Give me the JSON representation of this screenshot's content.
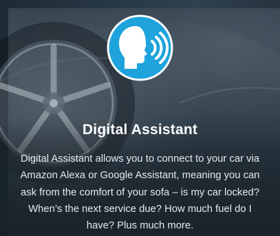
{
  "feature": {
    "title": "Digital Assistant",
    "description": "Digital Assistant allows you to connect to your car via Amazon Alexa or Google Assistant, meaning you can ask from the comfort of your sofa – is my car locked? When’s the next service due? How much fuel do I have? Plus much more.",
    "icon": "voice-assistant-icon",
    "accent_color": "#1ea3dd"
  }
}
